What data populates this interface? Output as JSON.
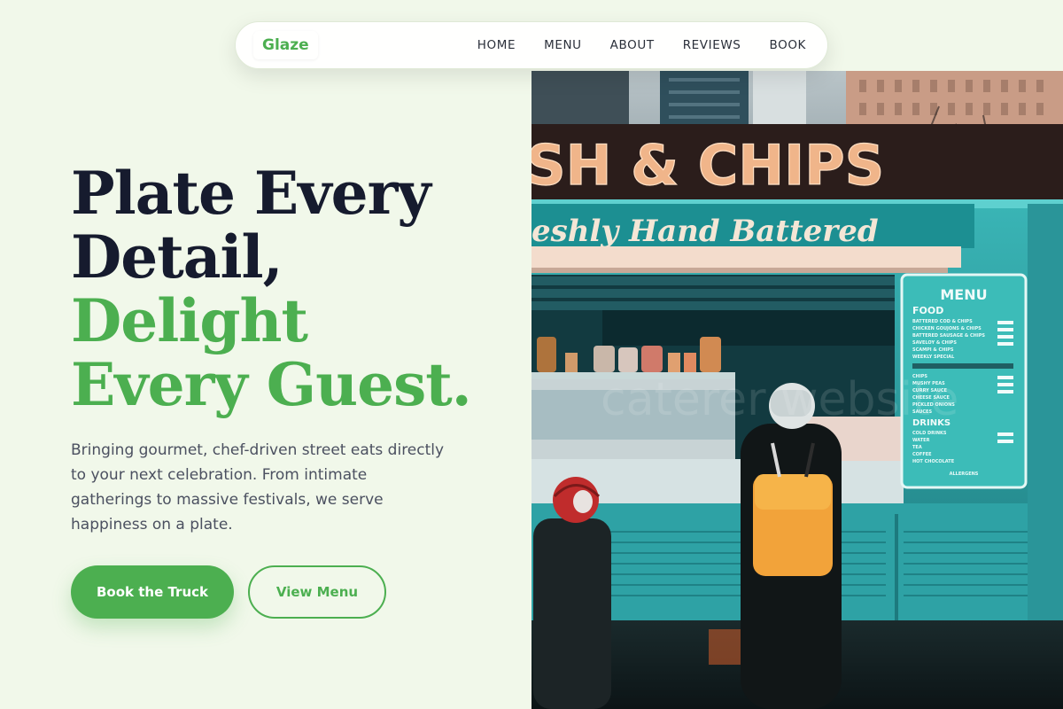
{
  "nav": {
    "brand": "Glaze",
    "links": [
      "HOME",
      "MENU",
      "ABOUT",
      "REVIEWS",
      "BOOK"
    ]
  },
  "hero": {
    "headline_dark": [
      "Plate Every",
      "Detail,"
    ],
    "headline_green": [
      "Delight",
      "Every Guest."
    ],
    "description": "Bringing gourmet, chef-driven street eats directly to your next celebration. From intimate gatherings to massive festivals, we serve happiness on a plate.",
    "primary_button": "Book the Truck",
    "secondary_button": "View Menu"
  },
  "image": {
    "sign_text": "SH & CHIPS",
    "banner_text": "eshly Hand Battered",
    "menu_board": {
      "title": "MENU",
      "food_heading": "FOOD",
      "food_items": [
        "BATTERED COD & CHIPS",
        "CHICKEN GOUJONS & CHIPS",
        "BATTERED SAUSAGE & CHIPS",
        "SAVELOY & CHIPS",
        "SCAMPI & CHIPS",
        "WEEKLY SPECIAL"
      ],
      "sides_items": [
        "CHIPS",
        "MUSHY PEAS",
        "CURRY SAUCE",
        "CHEESE SAUCE",
        "PICKLED ONIONS",
        "SAUCES"
      ],
      "drinks_heading": "DRINKS",
      "drinks_items": [
        "COLD DRINKS",
        "WATER",
        "TEA",
        "COFFEE",
        "HOT CHOCOLATE"
      ],
      "allergens": "ALLERGENS"
    },
    "watermark": "caterer website"
  },
  "colors": {
    "accent": "#4caf50",
    "background": "#f1f8ea",
    "heading_dark": "#161b2e",
    "truck_teal": "#2fa3a6"
  }
}
